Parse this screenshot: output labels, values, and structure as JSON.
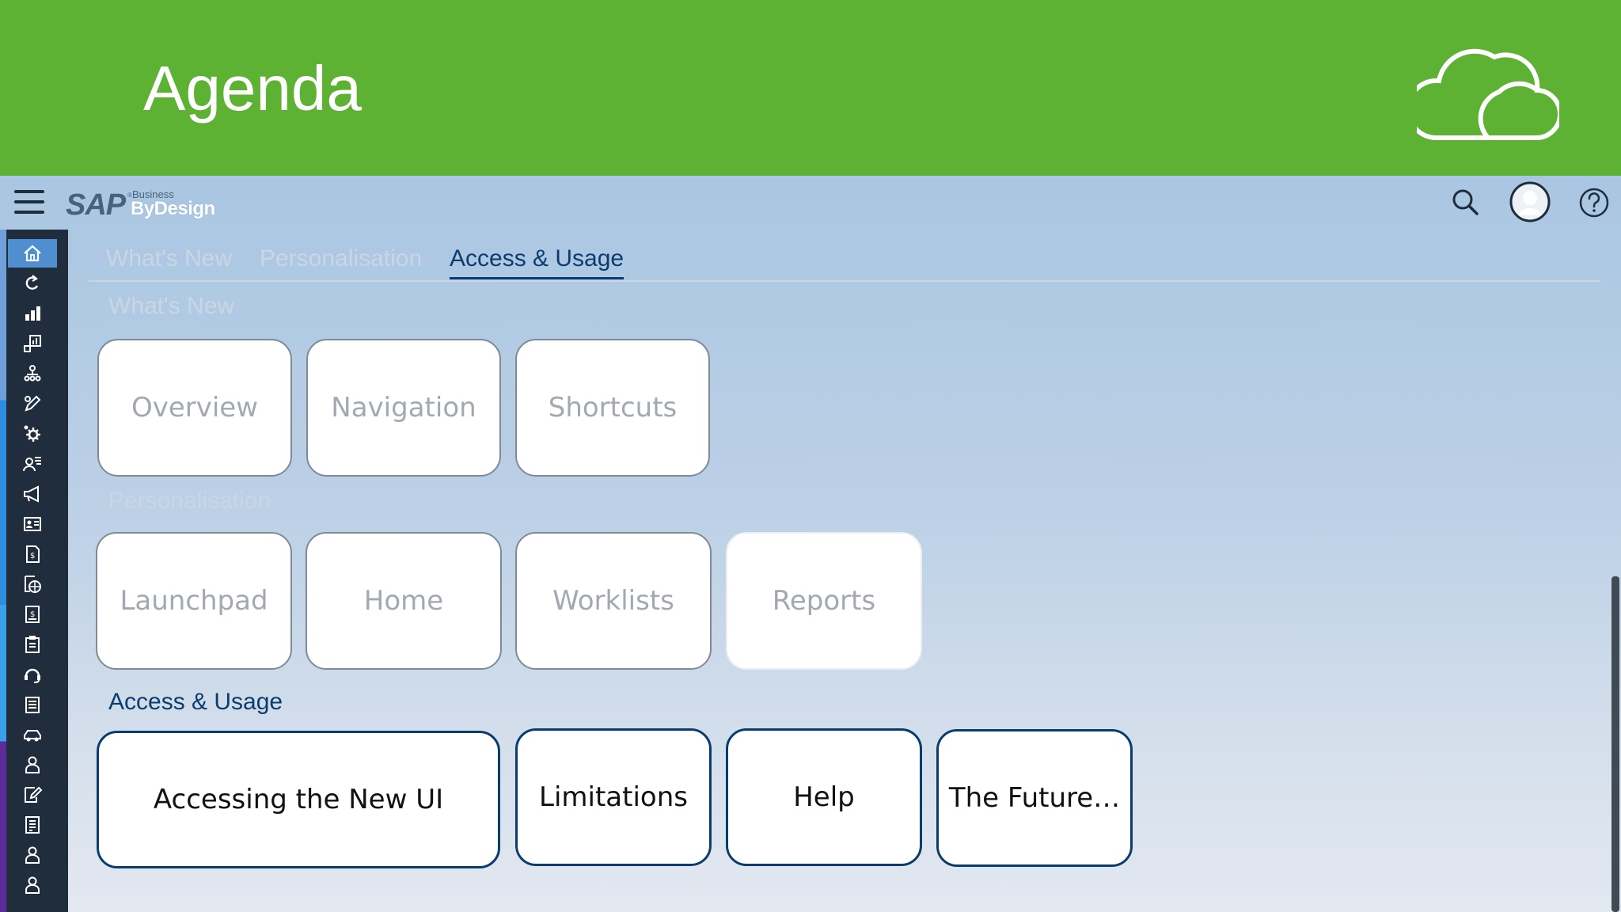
{
  "slide": {
    "title": "Agenda"
  },
  "shell": {
    "brand": {
      "sap": "SAP",
      "registered": "®",
      "business": "Business",
      "bydesign": "ByDesign"
    },
    "icons": {
      "menu": "hamburger-menu-icon",
      "search": "search-icon",
      "avatar": "user-avatar-icon",
      "help": "help-icon"
    }
  },
  "sidenav": {
    "items": [
      {
        "icon": "home-icon",
        "active": true
      },
      {
        "icon": "refresh-icon"
      },
      {
        "icon": "bar-chart-icon"
      },
      {
        "icon": "analytics-icon"
      },
      {
        "icon": "org-chart-icon"
      },
      {
        "icon": "edit-icon"
      },
      {
        "icon": "settings-icon"
      },
      {
        "icon": "user-list-icon"
      },
      {
        "icon": "megaphone-icon"
      },
      {
        "icon": "id-card-icon"
      },
      {
        "icon": "invoice-icon"
      },
      {
        "icon": "globe-document-icon"
      },
      {
        "icon": "finance-document-icon"
      },
      {
        "icon": "clipboard-icon"
      },
      {
        "icon": "headset-icon"
      },
      {
        "icon": "checklist-icon"
      },
      {
        "icon": "vehicle-icon"
      },
      {
        "icon": "employee-icon"
      },
      {
        "icon": "form-edit-icon"
      },
      {
        "icon": "ledger-icon"
      },
      {
        "icon": "person-icon"
      },
      {
        "icon": "person-icon-2"
      }
    ]
  },
  "tabs": [
    {
      "label": "What's New",
      "selected": false
    },
    {
      "label": "Personalisation",
      "selected": false
    },
    {
      "label": "Access & Usage",
      "selected": true
    }
  ],
  "sections": {
    "whats_new": {
      "title": "What's New",
      "tiles": [
        "Overview",
        "Navigation",
        "Shortcuts"
      ]
    },
    "personalisation": {
      "title": "Personalisation",
      "tiles": [
        "Launchpad",
        "Home",
        "Worklists",
        "Reports"
      ]
    },
    "access_usage": {
      "title": "Access & Usage",
      "tiles": [
        "Accessing the New UI",
        "Limitations",
        "Help",
        "The Future…"
      ]
    }
  },
  "colors": {
    "banner": "#5db133",
    "accent": "#0a3d6e",
    "sidenav": "#1f2d3d"
  }
}
